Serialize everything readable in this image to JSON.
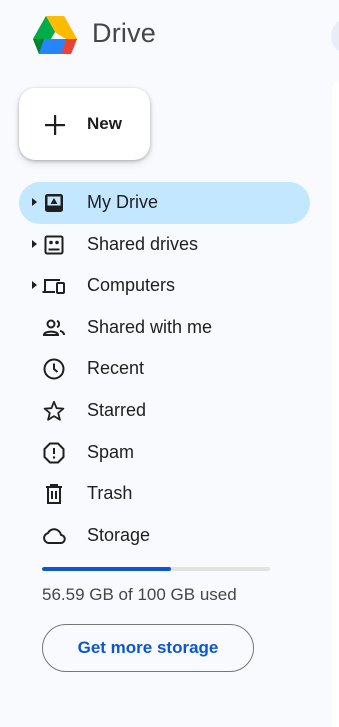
{
  "app": {
    "title": "Drive",
    "logo_icon": "google-drive-logo"
  },
  "new_button": {
    "label": "New",
    "icon": "plus-icon"
  },
  "sidebar": {
    "items": [
      {
        "label": "My Drive",
        "icon": "my-drive-icon",
        "expandable": true,
        "selected": true
      },
      {
        "label": "Shared drives",
        "icon": "shared-drives-icon",
        "expandable": true,
        "selected": false
      },
      {
        "label": "Computers",
        "icon": "computers-icon",
        "expandable": true,
        "selected": false
      },
      {
        "label": "Shared with me",
        "icon": "shared-with-me-icon",
        "expandable": false,
        "selected": false
      },
      {
        "label": "Recent",
        "icon": "clock-icon",
        "expandable": false,
        "selected": false
      },
      {
        "label": "Starred",
        "icon": "star-icon",
        "expandable": false,
        "selected": false
      },
      {
        "label": "Spam",
        "icon": "spam-icon",
        "expandable": false,
        "selected": false
      },
      {
        "label": "Trash",
        "icon": "trash-icon",
        "expandable": false,
        "selected": false
      },
      {
        "label": "Storage",
        "icon": "cloud-icon",
        "expandable": false,
        "selected": false
      }
    ]
  },
  "storage": {
    "used_fraction": 0.5659,
    "usage_text": "56.59 GB of 100 GB used",
    "get_more_label": "Get more storage"
  },
  "colors": {
    "selected_bg": "#c2e7ff",
    "accent_blue": "#0b57d0",
    "page_bg": "#f8fafd"
  }
}
